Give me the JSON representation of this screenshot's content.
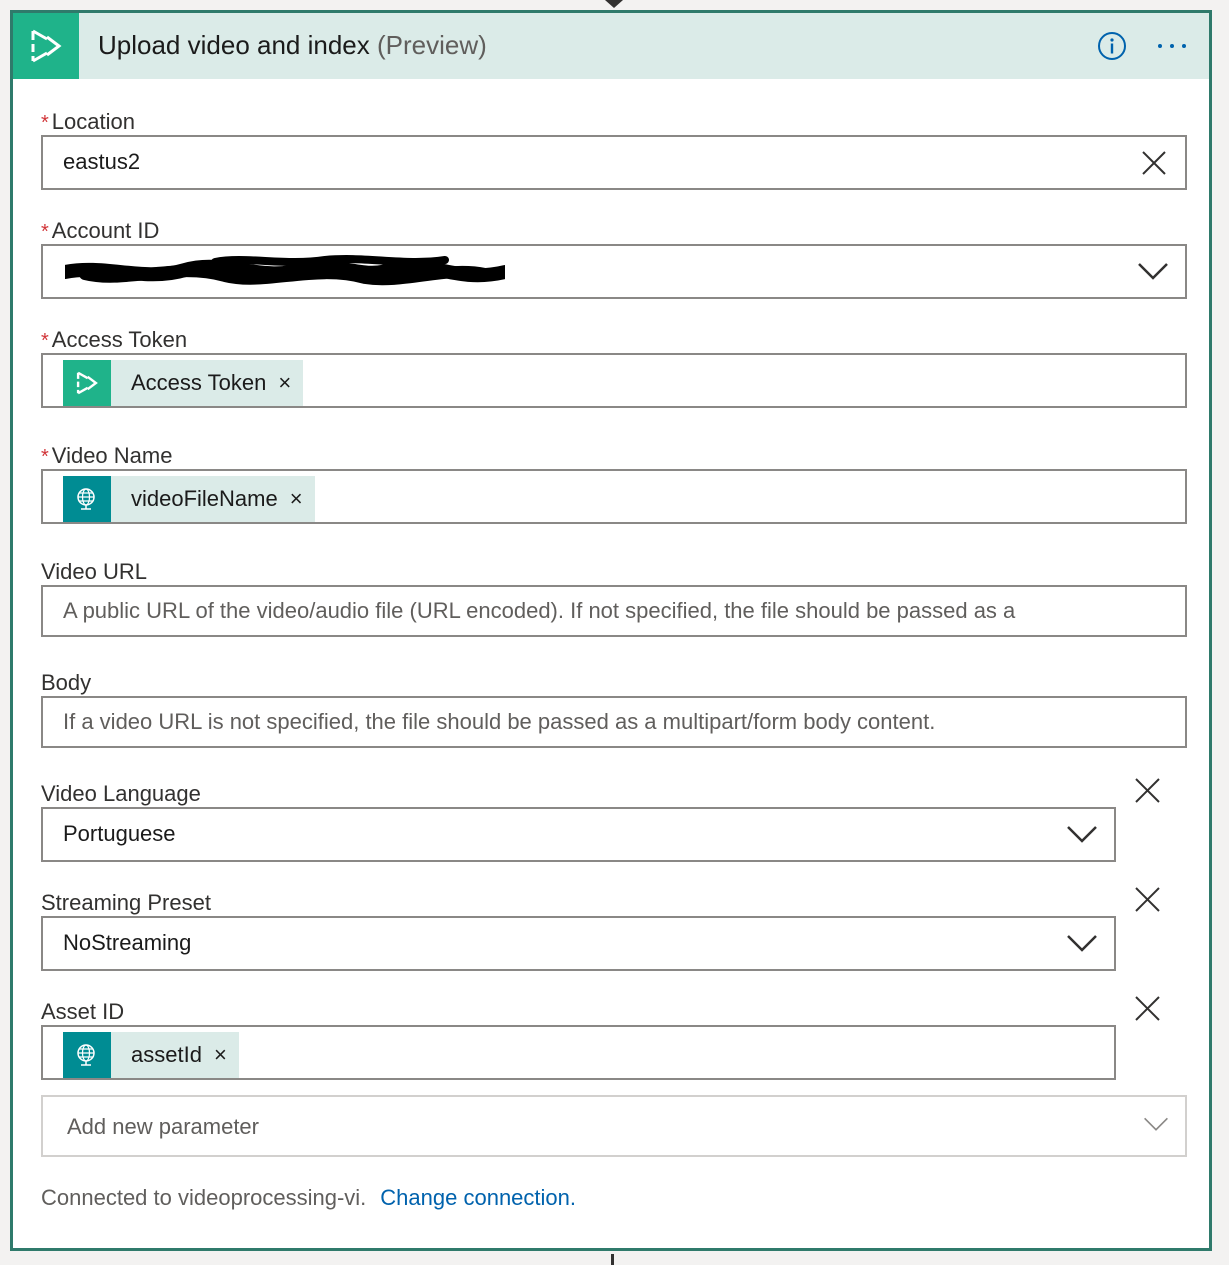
{
  "header": {
    "title": "Upload video and index",
    "title_suffix": "(Preview)",
    "info_icon": "info-icon",
    "more_icon": "more-options-icon"
  },
  "fields": {
    "location": {
      "label": "Location",
      "required_marker": "*",
      "value": "eastus2"
    },
    "account_id": {
      "label": "Account ID",
      "required_marker": "*"
    },
    "access_token": {
      "label": "Access Token",
      "required_marker": "*",
      "token_label": "Access Token",
      "token_close": "×"
    },
    "video_name": {
      "label": "Video Name",
      "required_marker": "*",
      "token_label": "videoFileName",
      "token_close": "×"
    },
    "video_url": {
      "label": "Video URL",
      "placeholder": "A public URL of the video/audio file (URL encoded). If not specified, the file should be passed as a"
    },
    "body": {
      "label": "Body",
      "placeholder": "If a video URL is not specified, the file should be passed as a multipart/form body content."
    },
    "video_language": {
      "label": "Video Language",
      "value": "Portuguese"
    },
    "streaming_preset": {
      "label": "Streaming Preset",
      "value": "NoStreaming"
    },
    "asset_id": {
      "label": "Asset ID",
      "token_label": "assetId",
      "token_close": "×"
    }
  },
  "add_parameter": {
    "placeholder": "Add new parameter"
  },
  "footer": {
    "connected_text": "Connected to videoprocessing-vi.",
    "change_link": "Change connection."
  },
  "colors": {
    "accent_green": "#1fb38a",
    "token_teal": "#008c93",
    "header_bg": "#dbebe8",
    "card_border": "#2f7a6b",
    "link": "#0062ad",
    "required": "#d13438"
  }
}
